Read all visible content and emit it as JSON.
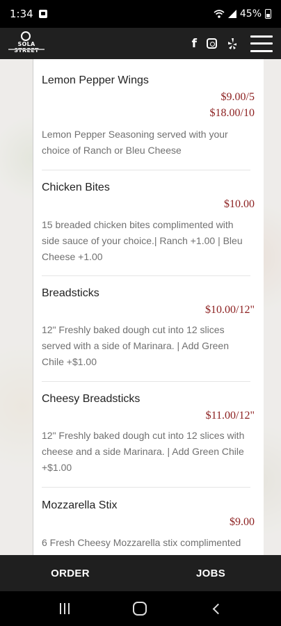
{
  "status": {
    "time": "1:34",
    "battery": "45%"
  },
  "header": {
    "logo_text": "SOLA STREET",
    "social": [
      "facebook-icon",
      "instagram-icon",
      "yelp-icon"
    ]
  },
  "menu": [
    {
      "name": "Lemon Pepper Wings",
      "prices": [
        "$9.00/5",
        "$18.00/10"
      ],
      "description": "Lemon Pepper Seasoning served with your choice of Ranch or Bleu Cheese"
    },
    {
      "name": "Chicken Bites",
      "prices": [
        "$10.00"
      ],
      "description": "15 breaded chicken bites complimented with side sauce of your choice.| Ranch +1.00 | Bleu Cheese +1.00"
    },
    {
      "name": "Breadsticks",
      "prices": [
        "$10.00/12\""
      ],
      "description": "12\" Freshly baked dough cut into 12 slices served with a side of Marinara. | Add Green Chile +$1.00"
    },
    {
      "name": "Cheesy Breadsticks",
      "prices": [
        "$11.00/12\""
      ],
      "description": "12\" Freshly baked dough cut into 12 slices with cheese and a side Marinara. | Add Green Chile +$1.00"
    },
    {
      "name": "Mozzarella Stix",
      "prices": [
        "$9.00"
      ],
      "description": "6 Fresh Cheesy Mozzarella stix complimented"
    }
  ],
  "bottom_nav": {
    "order": "ORDER",
    "jobs": "JOBS"
  },
  "colors": {
    "price": "#8b1e1e",
    "header_bg": "#202020"
  }
}
